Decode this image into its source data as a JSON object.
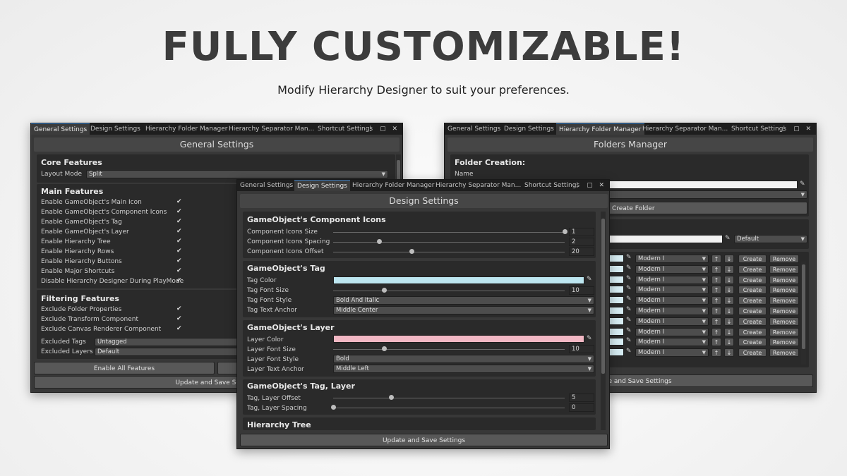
{
  "headline": "FULLY CUSTOMIZABLE!",
  "subline": "Modify Hierarchy Designer to suit your preferences.",
  "tabs": [
    "General Settings",
    "Design Settings",
    "Hierarchy Folder Manager",
    "Hierarchy Separator Man...",
    "Shortcut Settings"
  ],
  "window_controls": "⋮ ▢ ✕",
  "general": {
    "title": "General Settings",
    "core_header": "Core Features",
    "layout_label": "Layout Mode",
    "layout_value": "Split",
    "main_header": "Main Features",
    "main_items": [
      "Enable GameObject's Main Icon",
      "Enable GameObject's Component Icons",
      "Enable GameObject's Tag",
      "Enable GameObject's Layer",
      "Enable Hierarchy Tree",
      "Enable Hierarchy Rows",
      "Enable Hierarchy Buttons",
      "Enable Major Shortcuts",
      "Disable Hierarchy Designer During PlayMode"
    ],
    "filter_header": "Filtering Features",
    "filter_items": [
      "Exclude Folder Properties",
      "Exclude Transform Component",
      "Exclude Canvas Renderer Component"
    ],
    "excluded_tags_label": "Excluded Tags",
    "excluded_tags_value": "Untagged",
    "excluded_layers_label": "Excluded Layers",
    "excluded_layers_value": "Default",
    "enable_all": "Enable All Features",
    "update_save": "Update and Save Settings",
    "check": "✔"
  },
  "design": {
    "title": "Design Settings",
    "s1": "GameObject's Component Icons",
    "s1_rows": [
      {
        "label": "Component Icons Size",
        "value": "1",
        "pos": 1.0
      },
      {
        "label": "Component Icons Spacing",
        "value": "2",
        "pos": 0.2
      },
      {
        "label": "Component Icons Offset",
        "value": "20",
        "pos": 0.34
      }
    ],
    "s2": "GameObject's Tag",
    "tag_color_label": "Tag Color",
    "tag_color": "#bde6f0",
    "tag_font_size_label": "Tag Font Size",
    "tag_font_size": "10",
    "tag_font_size_pos": 0.22,
    "tag_font_style_label": "Tag Font Style",
    "tag_font_style": "Bold And Italic",
    "tag_anchor_label": "Tag Text Anchor",
    "tag_anchor": "Middle Center",
    "s3": "GameObject's Layer",
    "layer_color_label": "Layer Color",
    "layer_color": "#f2b8c4",
    "layer_font_size_label": "Layer Font Size",
    "layer_font_size": "10",
    "layer_font_size_pos": 0.22,
    "layer_font_style_label": "Layer Font Style",
    "layer_font_style": "Bold",
    "layer_anchor_label": "Layer Text Anchor",
    "layer_anchor": "Middle Left",
    "s4": "GameObject's Tag, Layer",
    "offset_label": "Tag, Layer Offset",
    "offset": "5",
    "offset_pos": 0.25,
    "spacing_label": "Tag, Layer Spacing",
    "spacing": "0",
    "spacing_pos": 0.0,
    "s5": "Hierarchy Tree",
    "update_save": "Update and Save Settings"
  },
  "folders": {
    "title": "Folders Manager",
    "creation_header": "Folder Creation:",
    "name_label": "Name",
    "create_folder": "Create Folder",
    "default_value": "Default",
    "row_style": "Modern I",
    "up": "↑",
    "down": "↓",
    "create": "Create",
    "remove": "Remove",
    "update_save": "Update and Save Settings"
  }
}
